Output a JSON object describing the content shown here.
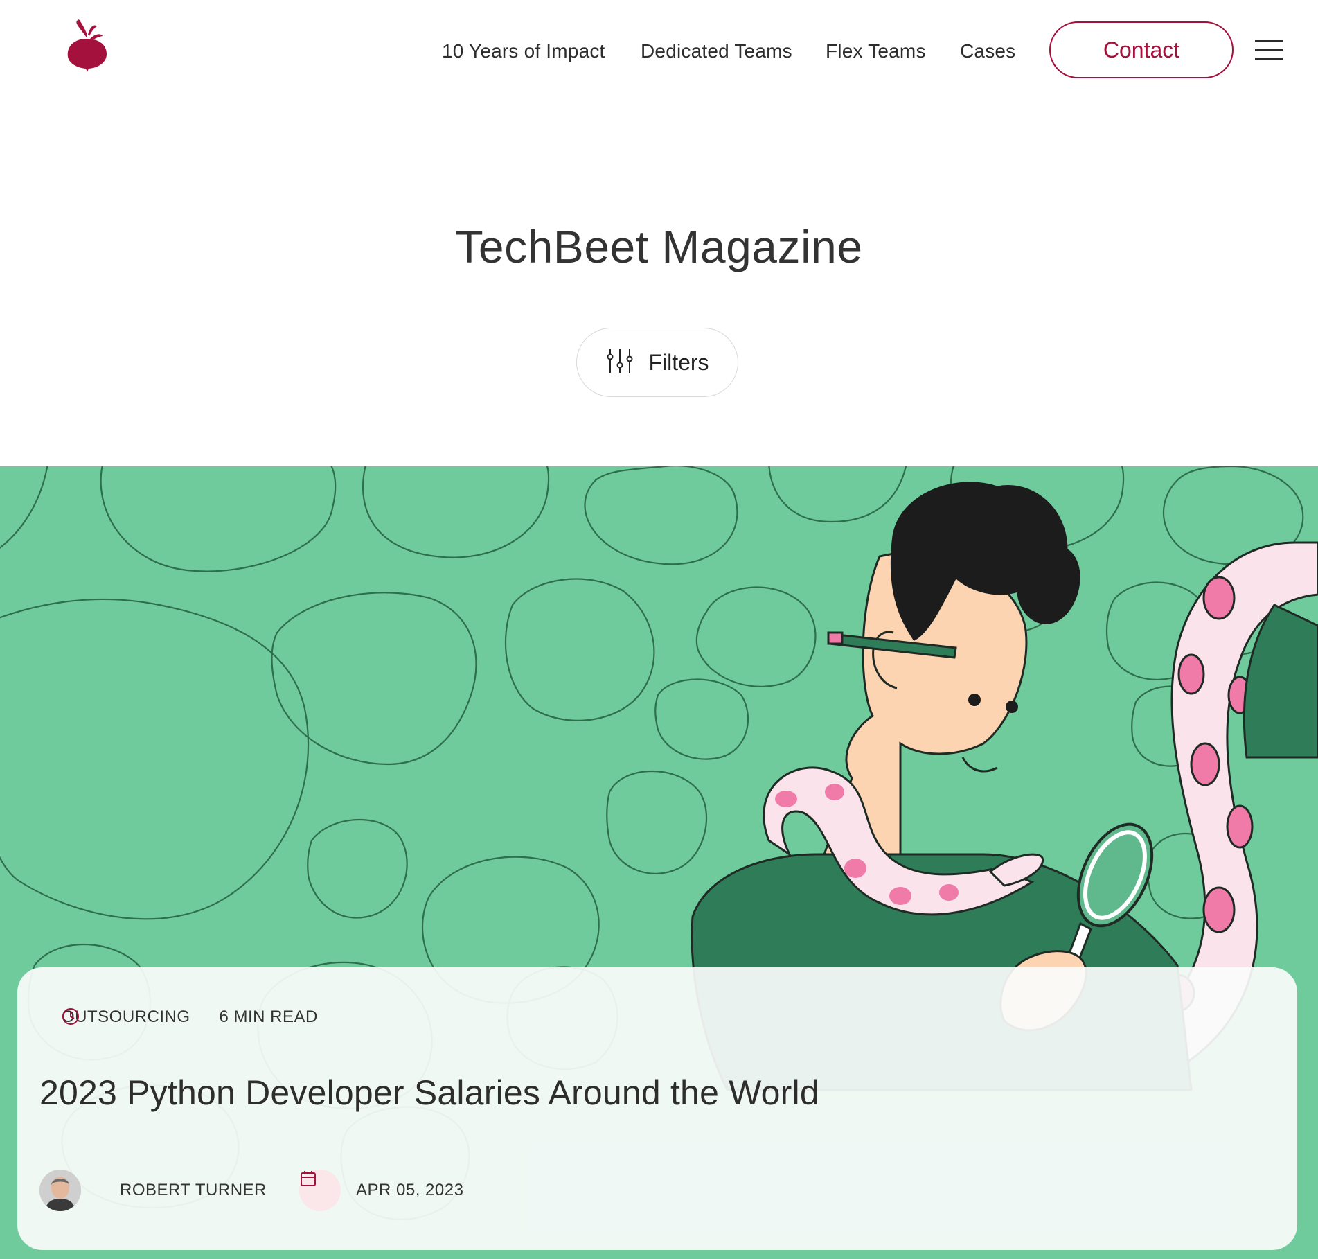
{
  "colors": {
    "brand": "#a4113d",
    "hero_bg": "#6fcb9c",
    "hero_outline": "#2f6e4c"
  },
  "header": {
    "logo_icon": "beet-icon",
    "nav": [
      "10 Years of Impact",
      "Dedicated Teams",
      "Flex Teams",
      "Cases"
    ],
    "contact_label": "Contact",
    "menu_icon": "hamburger-icon"
  },
  "main": {
    "title": "TechBeet Magazine",
    "filters_label": "Filters",
    "filters_icon": "sliders-icon"
  },
  "featured": {
    "category": "OUTSOURCING",
    "read_time": "6 MIN READ",
    "read_time_icon": "clock-icon",
    "title": "2023 Python Developer Salaries Around the World",
    "author": "ROBERT TURNER",
    "date_icon": "calendar-icon",
    "date": "APR 05, 2023"
  }
}
